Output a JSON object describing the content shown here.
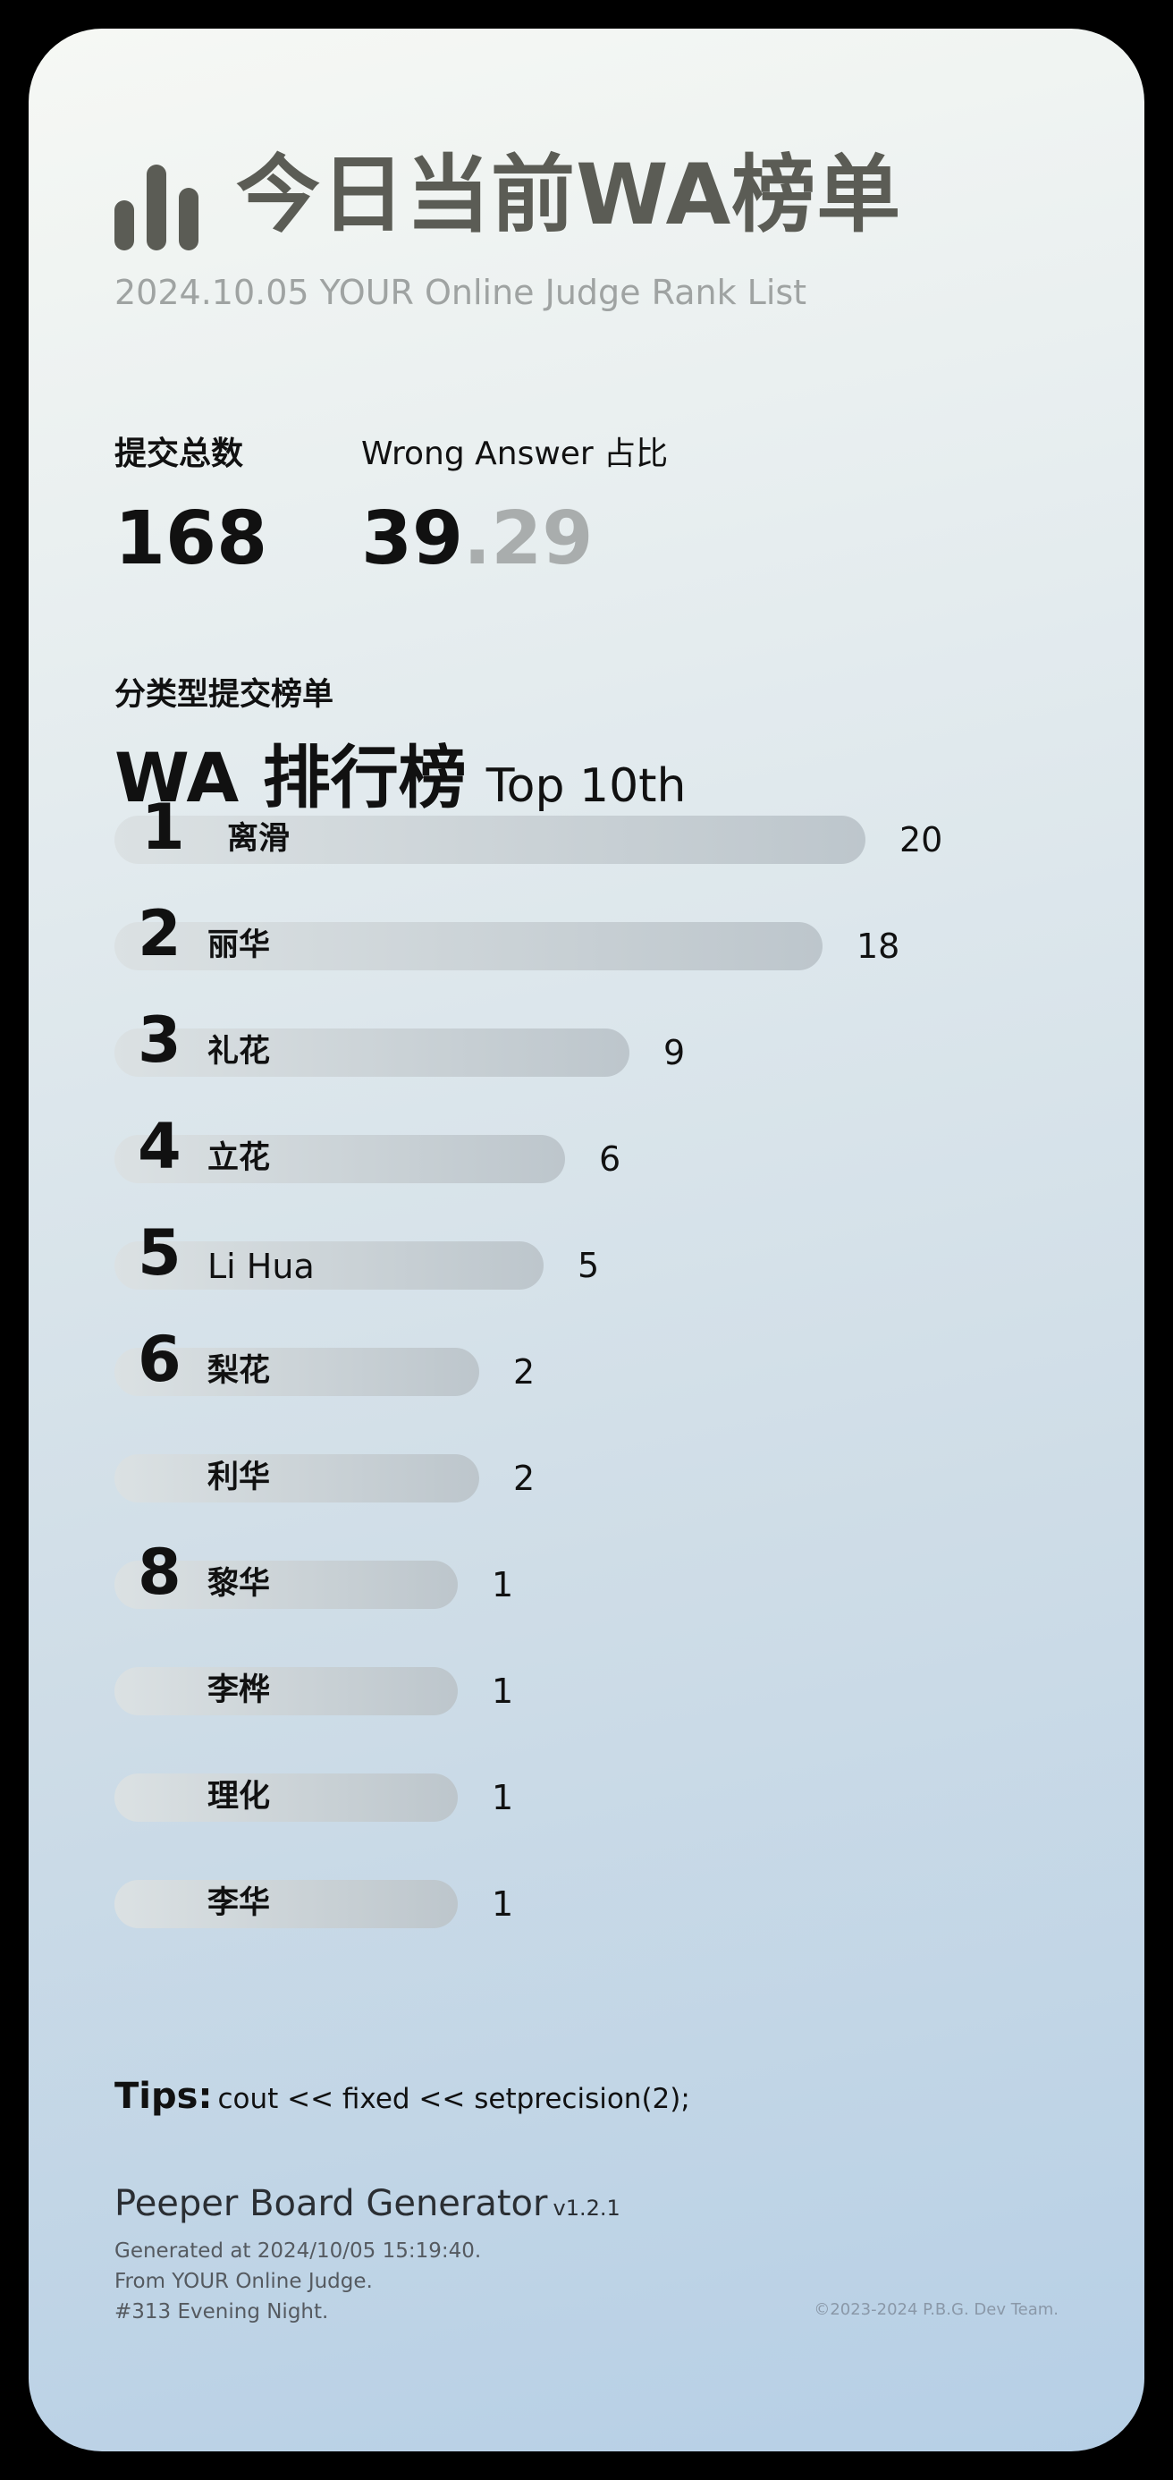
{
  "header": {
    "title": "今日当前WA榜单",
    "subtitle": "2024.10.05  YOUR Online Judge Rank List",
    "icon": "bar-chart-icon"
  },
  "stats": {
    "total_label": "提交总数",
    "total_value": "168",
    "wa_label": "Wrong Answer 占比",
    "wa_value_int": "39",
    "wa_value_frac": ".29"
  },
  "ranking": {
    "category_label": "分类型提交榜单",
    "title": "WA 排行榜",
    "subtitle": "Top 10th",
    "max_count": 20,
    "rows": [
      {
        "rank": "1",
        "name": "离滑",
        "count": "20",
        "value": 20
      },
      {
        "rank": "2",
        "name": "丽华",
        "count": "18",
        "value": 18
      },
      {
        "rank": "3",
        "name": "礼花",
        "count": "9",
        "value": 9
      },
      {
        "rank": "4",
        "name": "立花",
        "count": "6",
        "value": 6
      },
      {
        "rank": "5",
        "name": "Li Hua",
        "count": "5",
        "value": 5
      },
      {
        "rank": "6",
        "name": "梨花",
        "count": "2",
        "value": 2
      },
      {
        "rank": "",
        "name": "利华",
        "count": "2",
        "value": 2
      },
      {
        "rank": "8",
        "name": "黎华",
        "count": "1",
        "value": 1
      },
      {
        "rank": "",
        "name": "李桦",
        "count": "1",
        "value": 1
      },
      {
        "rank": "",
        "name": "理化",
        "count": "1",
        "value": 1
      },
      {
        "rank": "",
        "name": "李华",
        "count": "1",
        "value": 1
      }
    ]
  },
  "tips": {
    "label": "Tips:",
    "text": "cout << fixed << setprecision(2);"
  },
  "footer": {
    "generator": "Peeper Board Generator",
    "version": "v1.2.1",
    "generated_at": "Generated at 2024/10/05 15:19:40.",
    "from": "From YOUR Online Judge.",
    "session": "#313 Evening Night.",
    "copyright": "©2023-2024 P.B.G. Dev Team."
  }
}
